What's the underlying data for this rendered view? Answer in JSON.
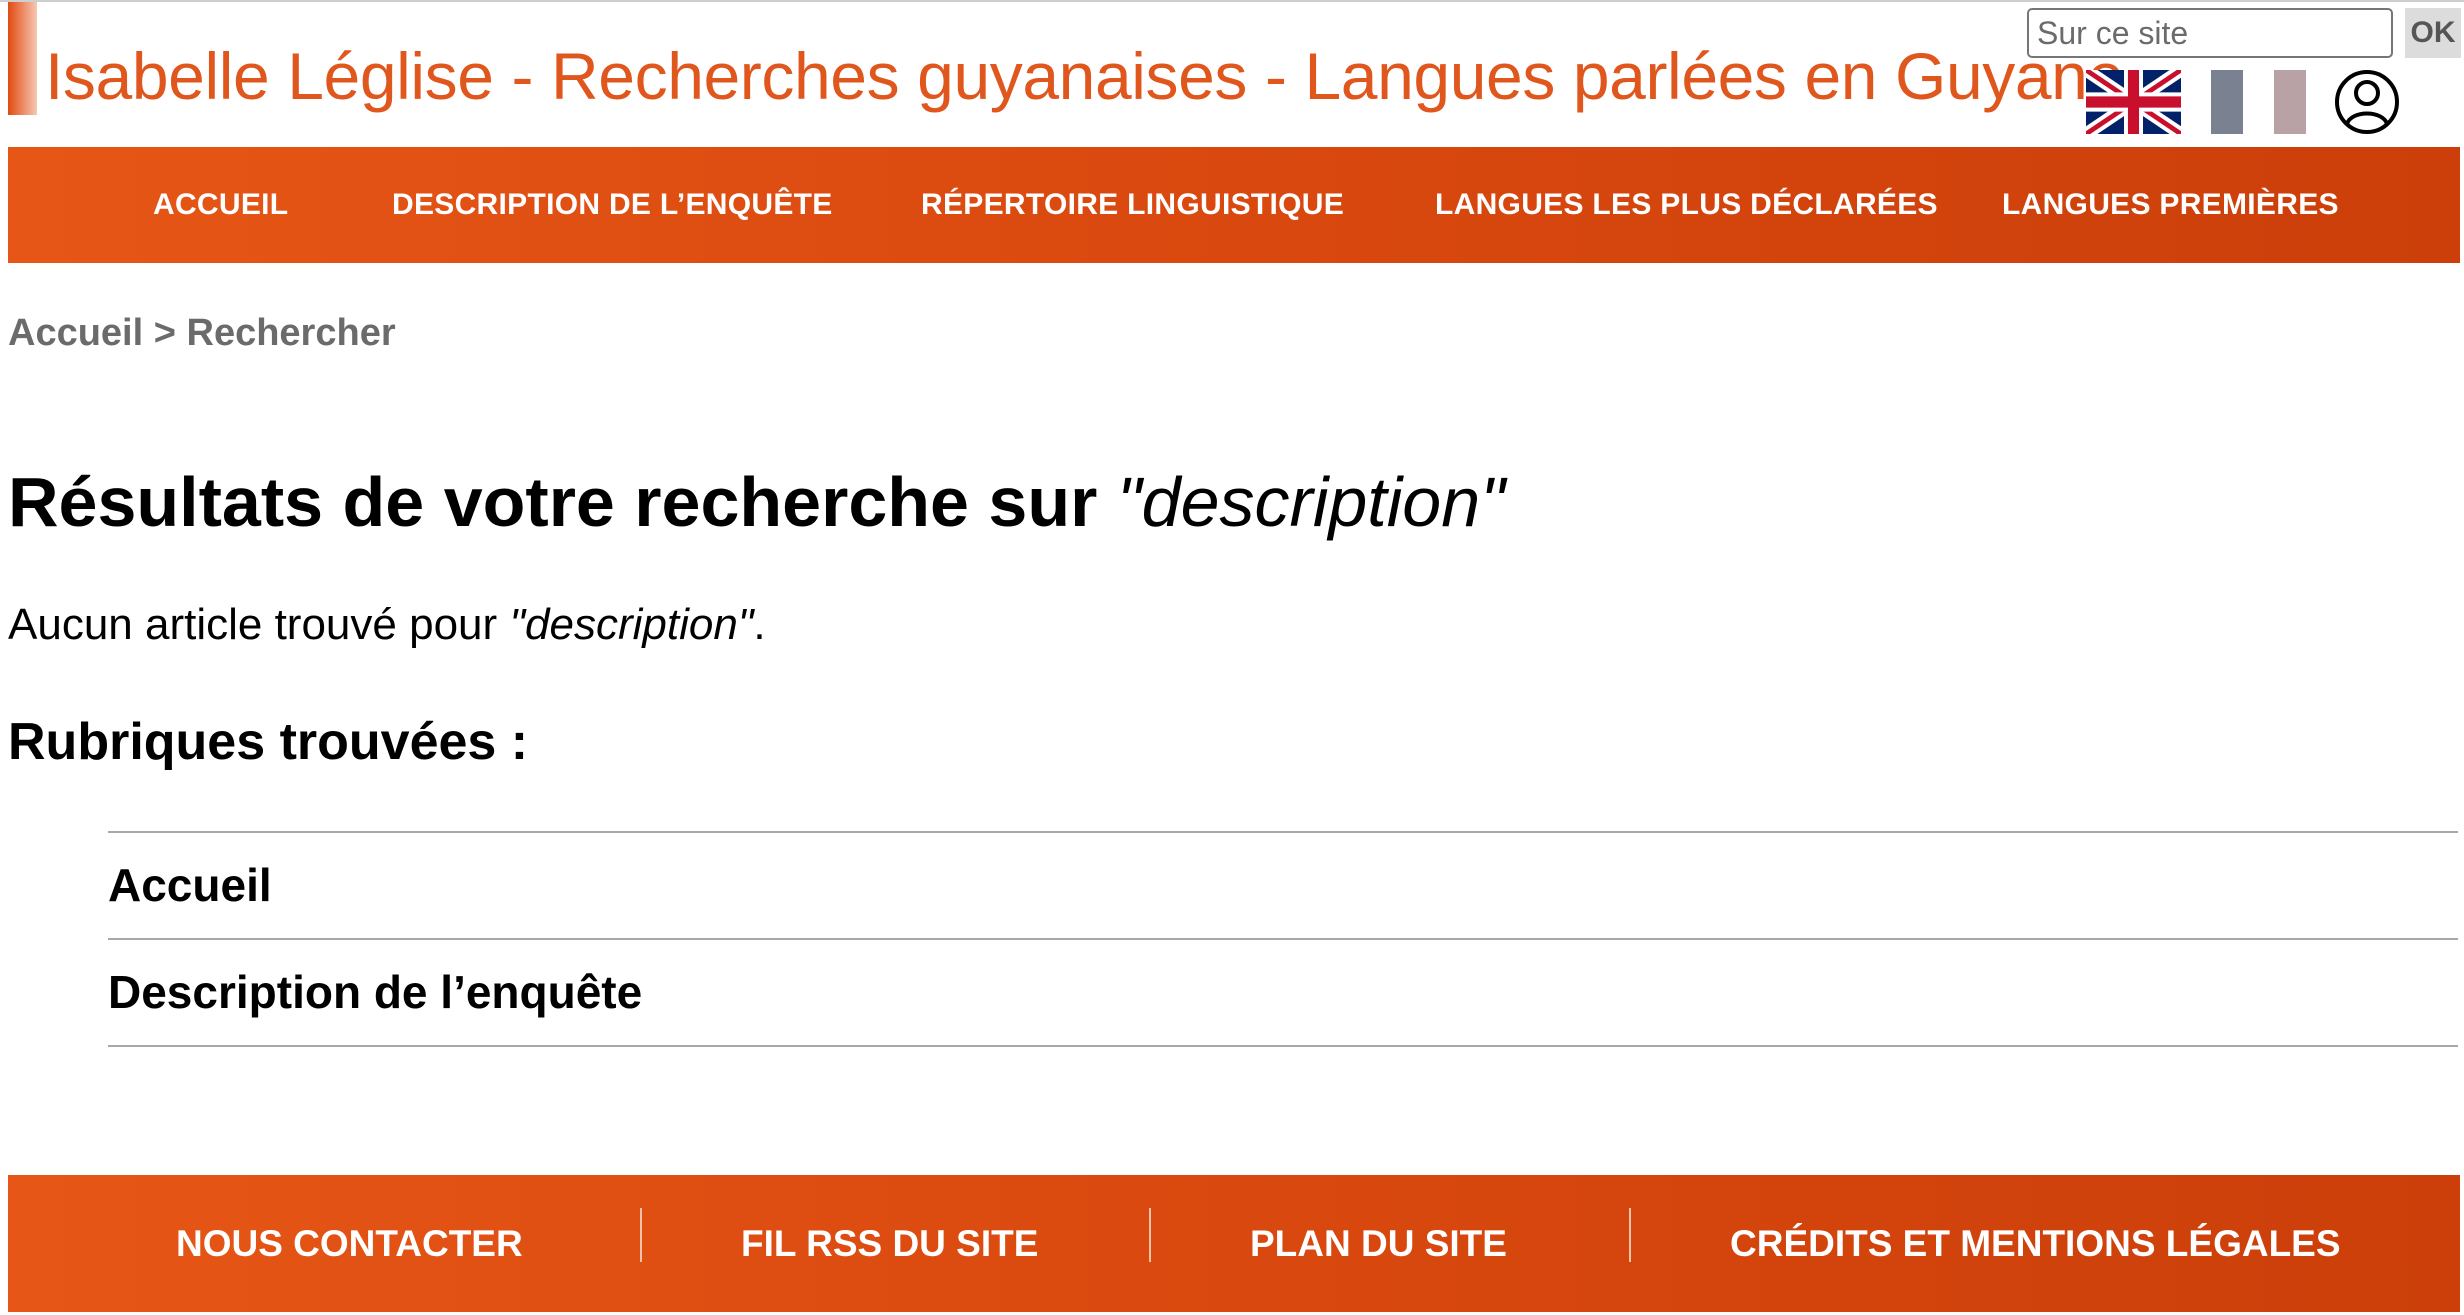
{
  "header": {
    "site_title": "Isabelle Léglise - Recherches guyanaises - Langues parlées en Guyane",
    "search_placeholder": "Sur ce site",
    "search_value": "",
    "search_button": "OK",
    "icons": [
      "uk-flag-icon",
      "french-flag-icon",
      "user-account-icon"
    ],
    "brand_color": "#e0571e",
    "nav_color": "#d9490f"
  },
  "nav": {
    "items": [
      "Accueil",
      "Description de l’enquête",
      "Répertoire linguistique",
      "Langues les plus déclarées",
      "Langues premières"
    ]
  },
  "breadcrumb": {
    "home": "Accueil",
    "separator": ">",
    "current": "Rechercher"
  },
  "results": {
    "title_prefix": "Résultats de votre recherche sur ",
    "query": "\"description\"",
    "no_article_prefix": "Aucun article trouvé pour ",
    "no_article_suffix": ".",
    "rubriques_heading": "Rubriques trouvées :",
    "rubriques": [
      "Accueil",
      "Description de l’enquête"
    ]
  },
  "footer": {
    "items": [
      "Nous contacter",
      "Fil RSS du site",
      "Plan du site",
      "Crédits et mentions légales"
    ]
  }
}
